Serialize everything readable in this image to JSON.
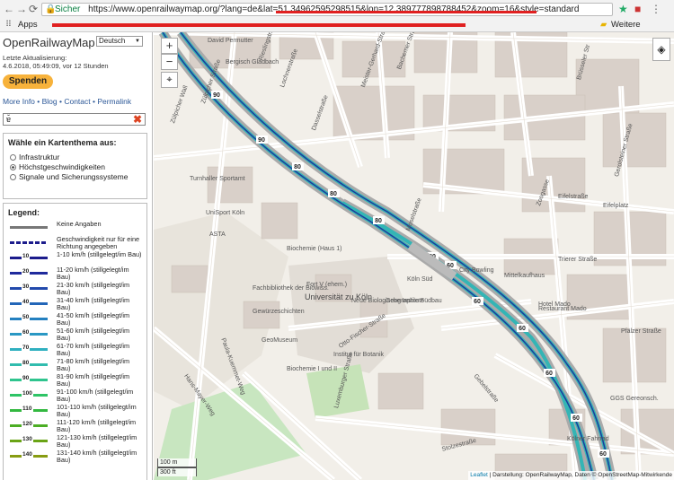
{
  "browser": {
    "secure_label": "Sicher",
    "url": "https://www.openrailwaymap.org/?lang=de&lat=51.34962595298515&lon=12.389777898788452&zoom=16&style=standard",
    "apps_label": "Apps",
    "other_bookmarks": "Weitere Lesezeichen"
  },
  "sidebar": {
    "logo": "OpenRailwayMap",
    "language": "Deutsch",
    "update_line1": "Letzte Aktualisierung:",
    "update_line2": "4.6.2018, 05:49:09, vor 12 Stunden",
    "donate": "Spenden",
    "links": [
      "More Info",
      "Blog",
      "Contact",
      "Permalink"
    ],
    "search_value": "ɐ̌",
    "theme_title": "Wähle ein Kartenthema aus:",
    "themes": [
      "Infrastruktur",
      "Höchstgeschwindigkeiten",
      "Signale und Sicherungssysteme"
    ],
    "theme_selected": 1,
    "legend_title": "Legend:",
    "legend": [
      {
        "num": "",
        "color": "#777777",
        "text": "Keine Angaben"
      },
      {
        "num": "",
        "color": "#1c1c8c",
        "text": "Geschwindigkeit nur für eine Richtung angegeben"
      },
      {
        "num": "10",
        "color": "#1c1c8c",
        "text": "1-10 km/h (stillgelegt/im Bau)"
      },
      {
        "num": "20",
        "color": "#1f2a9c",
        "text": "11-20 km/h (stillgelegt/im Bau)"
      },
      {
        "num": "30",
        "color": "#224aac",
        "text": "21-30 km/h (stillgelegt/im Bau)"
      },
      {
        "num": "40",
        "color": "#2366b8",
        "text": "31-40 km/h (stillgelegt/im Bau)"
      },
      {
        "num": "50",
        "color": "#2480c0",
        "text": "41-50 km/h (stillgelegt/im Bau)"
      },
      {
        "num": "60",
        "color": "#2a98c4",
        "text": "51-60 km/h (stillgelegt/im Bau)"
      },
      {
        "num": "70",
        "color": "#2fb0c0",
        "text": "61-70 km/h (stillgelegt/im Bau)"
      },
      {
        "num": "80",
        "color": "#30bcae",
        "text": "71-80 km/h (stillgelegt/im Bau)"
      },
      {
        "num": "90",
        "color": "#2fc48e",
        "text": "81-90 km/h (stillgelegt/im Bau)"
      },
      {
        "num": "100",
        "color": "#2ec466",
        "text": "91-100 km/h (stillgelegt/im Bau)"
      },
      {
        "num": "110",
        "color": "#33b840",
        "text": "101-110 km/h (stillgelegt/im Bau)"
      },
      {
        "num": "120",
        "color": "#4cae24",
        "text": "111-120 km/h (stillgelegt/im Bau)"
      },
      {
        "num": "130",
        "color": "#6aa416",
        "text": "121-130 km/h (stillgelegt/im Bau)"
      },
      {
        "num": "140",
        "color": "#879c12",
        "text": "131-140 km/h (stillgelegt/im Bau)"
      }
    ]
  },
  "map": {
    "labels": [
      "David Permutter",
      "Bergisch Gladbach",
      "Rieslingstraße",
      "Lochnerstraße",
      "Meister-Gerhard-Straße",
      "Bachemer Straße",
      "Dasselstraße",
      "Zülpicher Wall",
      "Zülpicher Straße",
      "Turnhaller Sportamt",
      "UniSport Köln",
      "ASTA",
      "Biochemie (Haus 1)",
      "Fachbibliothek der Biowiss.",
      "Gewürzeschichten",
      "GeoMuseum",
      "Fort V (ehem.)",
      "Universität zu Köln",
      "Neue Biologische Institute",
      "Geographie Südbau",
      "Institut für Botanik",
      "Otto-Fischer-Straße",
      "Biochemie I und II",
      "Paula-Kuemmet-Weg",
      "Hans-Mayer-Weg",
      "Luxemburger Straße",
      "Köln Süd",
      "Moselstraße",
      "City Bowling",
      "Hotel Mado",
      "Trierer Straße",
      "Eifelplatz",
      "Pfälzer Straße",
      "Gerolsteiner Straße",
      "Zoogasse",
      "Kölner Fahrrad",
      "Stolzestraße",
      "Gebelstraße",
      "GGS Gereonsch.",
      "Mittelkaufhaus",
      "Eifelstraße",
      "Restaurant Mado",
      "Brüsseler Str"
    ],
    "speed_labels": [
      "90",
      "80",
      "60"
    ],
    "zoom_in": "+",
    "zoom_out": "−",
    "scale_metric": "100 m",
    "scale_imperial": "300 ft",
    "attribution_link": "Leaflet",
    "attribution_text": "Darstellung: OpenRailwayMap, Daten © OpenStreetMap-Mitwirkende",
    "colors": {
      "line_teal": "#33b5b5",
      "line_blue": "#1c3c9c",
      "road": "#ffffff",
      "building": "#d9d0c9",
      "park": "#c8e6c0"
    }
  }
}
